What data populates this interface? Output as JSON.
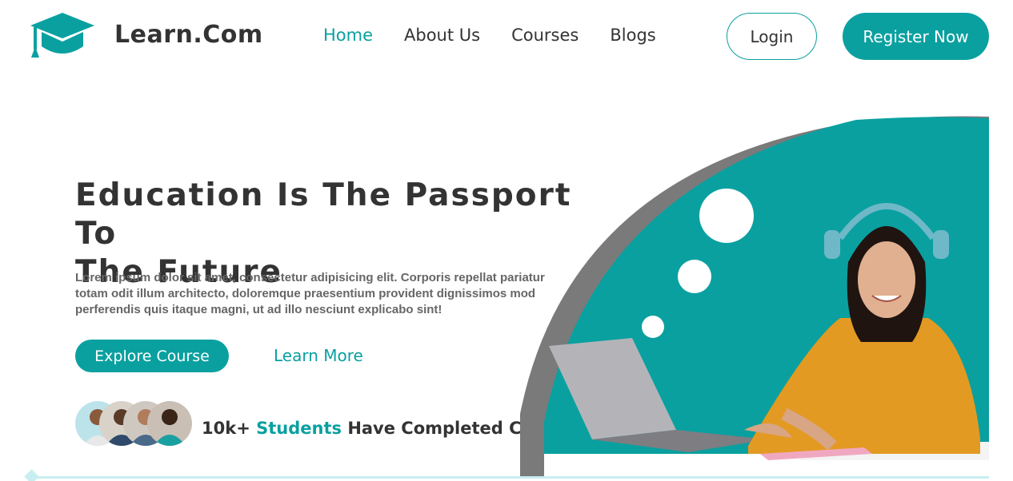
{
  "brand": {
    "name": "Learn.Com",
    "icon": "graduation-cap-icon",
    "accent": "#0aa0a0"
  },
  "nav": {
    "items": [
      {
        "label": "Home",
        "active": true
      },
      {
        "label": "About Us",
        "active": false
      },
      {
        "label": "Courses",
        "active": false
      },
      {
        "label": "Blogs",
        "active": false
      }
    ]
  },
  "auth": {
    "login_label": "Login",
    "register_label": "Register Now"
  },
  "hero": {
    "title_line1": "Education Is The Passport To",
    "title_line2": "The Future",
    "text_line1": "Lorem ipsum dolor sit amet, consectetur adipisicing elit. Corporis repellat pariatur",
    "text_line2": "totam odit illum architecto, doloremque praesentium provident dignissimos mod",
    "text_line3": "perferendis quis itaque magni, ut ad illo nesciunt explicabo sint!",
    "explore_label": "Explore Course",
    "learn_more_label": "Learn More"
  },
  "students": {
    "count": "10k+",
    "accent_word": "Students",
    "suffix": "Have Completed Course"
  }
}
